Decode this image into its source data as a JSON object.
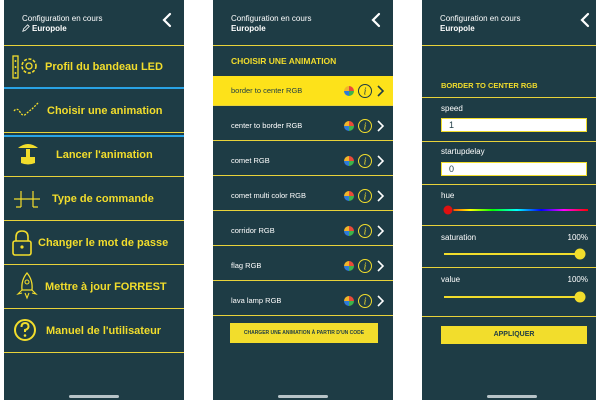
{
  "header": {
    "config_label": "Configuration en cours",
    "config_name": "Europole"
  },
  "screen1": {
    "menu": [
      {
        "label": "Profil du bandeau LED",
        "icon": "led-strip-settings-icon"
      },
      {
        "label": "Choisir une animation",
        "icon": "animation-wave-icon",
        "selected": true
      },
      {
        "label": "Lancer l'animation",
        "icon": "lamp-icon"
      },
      {
        "label": "Type de commande",
        "icon": "command-type-icon"
      },
      {
        "label": "Changer le mot de passe",
        "icon": "padlock-icon"
      },
      {
        "label": "Mettre à jour FORREST",
        "icon": "rocket-icon"
      },
      {
        "label": "Manuel de l'utilisateur",
        "icon": "help-circle-icon"
      }
    ],
    "accent_color": "#f2dd2c",
    "selection_color": "#29a3e5"
  },
  "screen2": {
    "section_title": "CHOISIR UNE ANIMATION",
    "animations": [
      {
        "label": "border to center RGB",
        "selected": true
      },
      {
        "label": "center to border RGB"
      },
      {
        "label": "comet RGB"
      },
      {
        "label": "comet multi color RGB"
      },
      {
        "label": "corridor RGB"
      },
      {
        "label": "flag RGB"
      },
      {
        "label": "lava lamp RGB"
      }
    ],
    "code_button": "CHARGER UNE ANIMATION À PARTIR D'UN CODE"
  },
  "screen3": {
    "title": "BORDER TO CENTER RGB",
    "speed": {
      "label": "speed",
      "value": "1"
    },
    "startupdelay": {
      "label": "startupdelay",
      "value": "0"
    },
    "hue": {
      "label": "hue",
      "value": 0
    },
    "saturation": {
      "label": "saturation",
      "percent": "100%",
      "value": 100
    },
    "value": {
      "label": "value",
      "percent": "100%",
      "value": 100
    },
    "apply_button": "APPLIQUER"
  },
  "colors": {
    "background": "#1e3c45",
    "accent": "#f2dd2c",
    "selected_row": "#fde21a",
    "hue_handle": "#e01010"
  }
}
